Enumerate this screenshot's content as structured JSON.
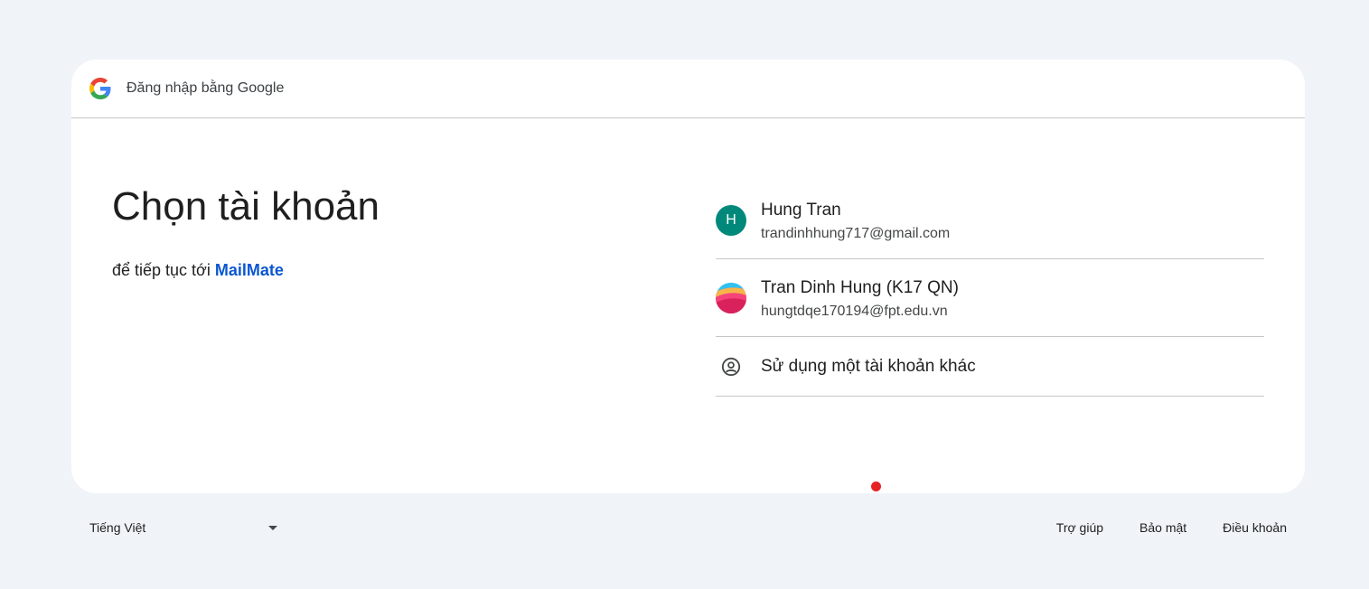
{
  "header": {
    "title": "Đăng nhập bằng Google"
  },
  "main": {
    "title": "Chọn tài khoản",
    "subtitle_prefix": "để tiếp tục tới",
    "app_name": "MailMate"
  },
  "accounts": [
    {
      "name": "Hung Tran",
      "email": "trandinhhung717@gmail.com",
      "avatar_letter": "H",
      "avatar_color": "#00897b"
    },
    {
      "name": "Tran Dinh Hung (K17 QN)",
      "email": "hungtdqe170194@fpt.edu.vn",
      "avatar_icon": "colorful-photo-avatar"
    }
  ],
  "other_account": {
    "label": "Sử dụng một tài khoản khác",
    "icon": "person-circle-icon"
  },
  "footer": {
    "language": "Tiếng Việt",
    "links": [
      "Trợ giúp",
      "Bảo mật",
      "Điều khoản"
    ]
  },
  "colors": {
    "link": "#0b57d0",
    "background": "#f0f4f9",
    "indicator": "#e52323"
  }
}
